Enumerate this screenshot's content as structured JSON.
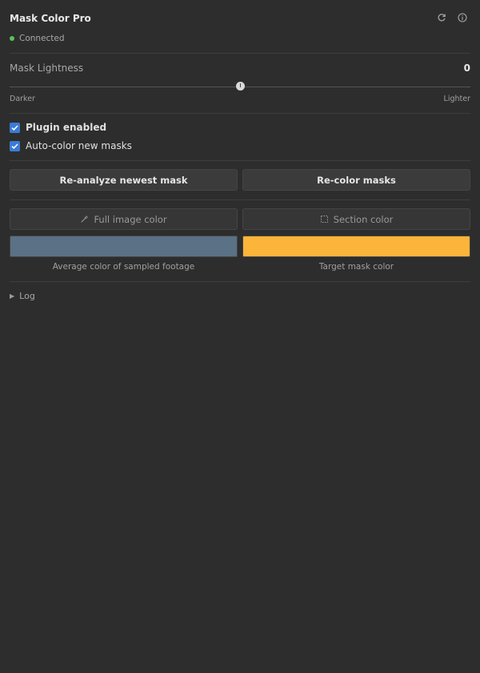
{
  "header": {
    "title": "Mask Color Pro",
    "status_text": "Connected",
    "status_color": "#5cc15c",
    "icons": [
      "refresh-icon",
      "info-icon"
    ]
  },
  "slider": {
    "label": "Mask Lightness",
    "value": "0",
    "min_label": "Darker",
    "max_label": "Lighter",
    "position_fraction": 0.5
  },
  "options": {
    "plugin_enabled_label": "Plugin enabled",
    "plugin_enabled_checked": true,
    "auto_color_label": "Auto-color new masks",
    "auto_color_checked": true
  },
  "actions": {
    "reanalyze_label": "Re-analyze newest mask",
    "recolor_label": "Re-color masks"
  },
  "sampling": {
    "full_image_label": "Full image color",
    "full_image_icon": "eyedropper-icon",
    "section_label": "Section color",
    "section_icon": "selection-icon",
    "average_color": "#5b7185",
    "average_label": "Average color of sampled footage",
    "target_color": "#fdb43a",
    "target_label": "Target mask color"
  },
  "log": {
    "label": "Log"
  },
  "colors": {
    "accent": "#3a7bd5",
    "background": "#2d2d2d"
  }
}
